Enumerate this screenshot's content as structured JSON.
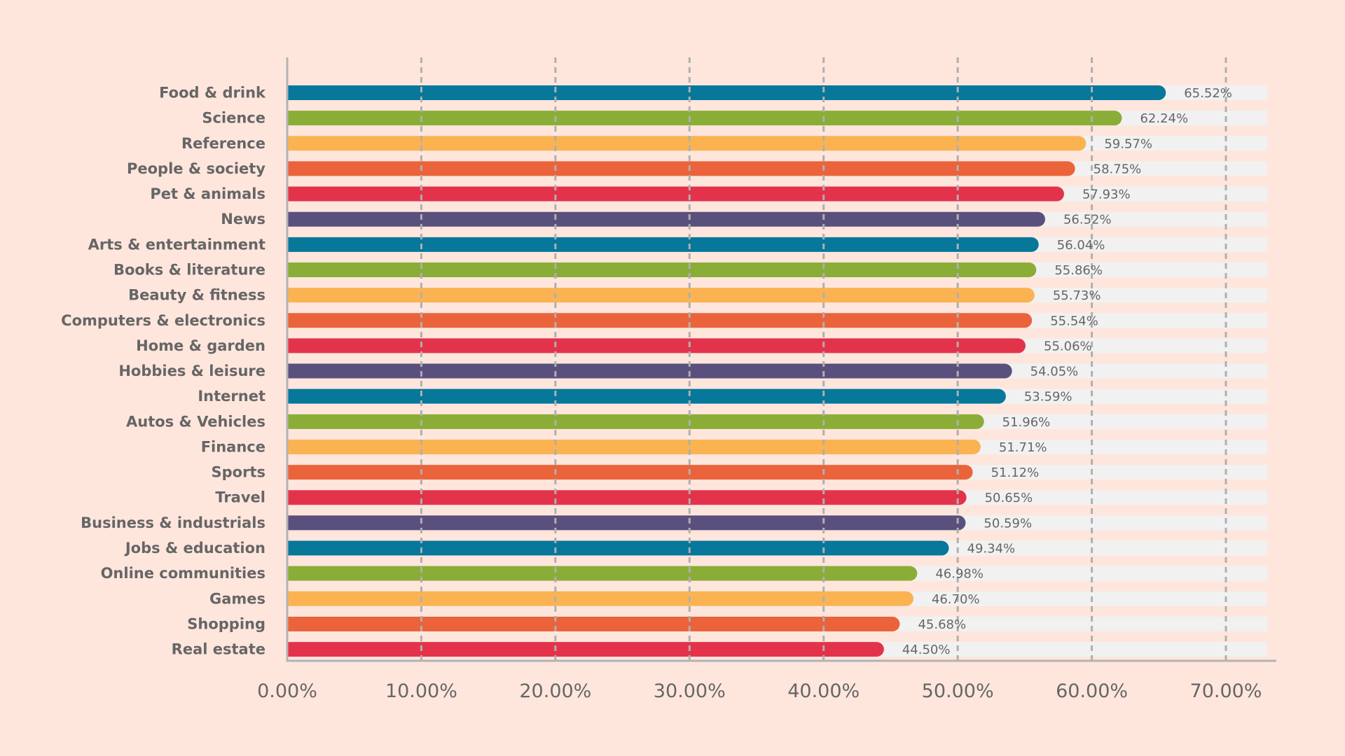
{
  "chart_data": {
    "type": "bar",
    "orientation": "horizontal",
    "title": "",
    "xlabel": "",
    "ylabel": "",
    "xlim": [
      0,
      70
    ],
    "x_ticks": [
      0,
      10,
      20,
      30,
      40,
      50,
      60,
      70
    ],
    "x_tick_labels": [
      "0.00%",
      "10.00%",
      "20.00%",
      "30.00%",
      "40.00%",
      "50.00%",
      "60.00%",
      "70.00%"
    ],
    "grid": "vertical dashed",
    "legend": "none",
    "categories": [
      "Food & drink",
      "Science",
      "Reference",
      "People & society",
      "Pet & animals",
      "News",
      "Arts & entertainment",
      "Books & literature",
      "Beauty & fitness",
      "Computers & electronics",
      "Home & garden",
      "Hobbies & leisure",
      "Internet",
      "Autos & Vehicles",
      "Finance",
      "Sports",
      "Travel",
      "Business & industrials",
      "Jobs & education",
      "Online communities",
      "Games",
      "Shopping",
      "Real estate"
    ],
    "values": [
      65.52,
      62.24,
      59.57,
      58.75,
      57.93,
      56.52,
      56.04,
      55.86,
      55.73,
      55.54,
      55.06,
      54.05,
      53.59,
      51.96,
      51.71,
      51.12,
      50.65,
      50.59,
      49.34,
      46.98,
      46.7,
      45.68,
      44.5
    ],
    "value_labels": [
      "65.52%",
      "62.24%",
      "59.57%",
      "58.75%",
      "57.93%",
      "56.52%",
      "56.04%",
      "55.86%",
      "55.73%",
      "55.54%",
      "55.06%",
      "54.05%",
      "53.59%",
      "51.96%",
      "51.71%",
      "51.12%",
      "50.65%",
      "50.59%",
      "49.34%",
      "46.98%",
      "46.70%",
      "45.68%",
      "44.50%"
    ],
    "color_cycle": [
      "#07779A",
      "#8AAD37",
      "#FBB351",
      "#EB633A",
      "#E3334B",
      "#5A507E"
    ],
    "track_color": "#F1F1F1",
    "background": "#FFE6DD"
  }
}
